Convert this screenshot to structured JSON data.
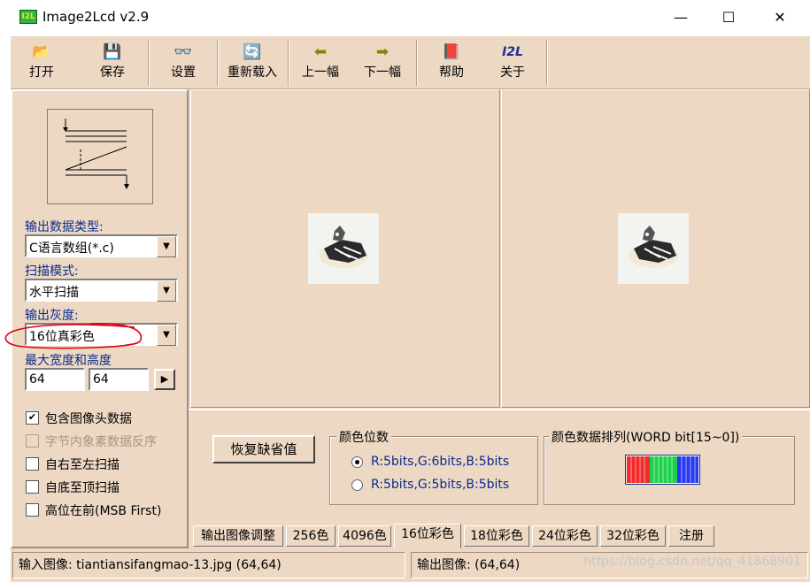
{
  "window": {
    "title": "Image2Lcd v2.9",
    "icon_text": "I2L",
    "colors": {
      "face": "#ecd8c3",
      "label_blue": "#0a2b8e"
    }
  },
  "window_controls": {
    "minimize": "—",
    "maximize": "☐",
    "close": "✕"
  },
  "toolbar": [
    {
      "label": "打开",
      "icon": "open-icon",
      "glyph": "📂"
    },
    {
      "label": "保存",
      "icon": "save-icon",
      "glyph": "💾"
    },
    {
      "label": "设置",
      "icon": "glasses-icon",
      "glyph": "👓"
    },
    {
      "label": "重新载入",
      "icon": "reload-icon",
      "glyph": "🔄"
    },
    {
      "label": "上一幅",
      "icon": "arrow-left-icon",
      "glyph": "⬅"
    },
    {
      "label": "下一幅",
      "icon": "arrow-right-icon",
      "glyph": "➡"
    },
    {
      "label": "帮助",
      "icon": "help-book-icon",
      "glyph": "📕"
    },
    {
      "label": "关于",
      "icon": "i2l-about-icon",
      "glyph": "I2L"
    }
  ],
  "left_panel": {
    "output_type_label": "输出数据类型:",
    "output_type_value": "C语言数组(*.c)",
    "scan_mode_label": "扫描模式:",
    "scan_mode_value": "水平扫描",
    "gray_label": "输出灰度:",
    "gray_value": "16位真彩色",
    "size_label": "最大宽度和高度",
    "width_value": "64",
    "height_value": "64",
    "size_arrow": "▶",
    "checkboxes": [
      {
        "label": "包含图像头数据",
        "checked": true,
        "enabled": true
      },
      {
        "label": "字节内象素数据反序",
        "checked": false,
        "enabled": false
      },
      {
        "label": "自右至左扫描",
        "checked": false,
        "enabled": true
      },
      {
        "label": "自底至顶扫描",
        "checked": false,
        "enabled": true
      },
      {
        "label": "高位在前(MSB First)",
        "checked": false,
        "enabled": true
      }
    ]
  },
  "settings": {
    "restore_button": "恢复缺省值",
    "color_bits_title": "颜色位数",
    "radios": [
      {
        "label": "R:5bits,G:6bits,B:5bits",
        "selected": true
      },
      {
        "label": "R:5bits,G:5bits,B:5bits",
        "selected": false
      }
    ],
    "order_title": "颜色数据排列(WORD bit[15~0])"
  },
  "tabs": [
    {
      "label": "输出图像调整",
      "active": false
    },
    {
      "label": "256色",
      "active": false
    },
    {
      "label": "4096色",
      "active": false
    },
    {
      "label": "16位彩色",
      "active": true
    },
    {
      "label": "18位彩色",
      "active": false
    },
    {
      "label": "24位彩色",
      "active": false
    },
    {
      "label": "32位彩色",
      "active": false
    },
    {
      "label": "注册",
      "active": false
    }
  ],
  "status": {
    "input": "输入图像: tiantiansifangmao-13.jpg (64,64)",
    "output": "输出图像: (64,64)",
    "watermark": "https://blog.csdn.net/qq_41868901"
  }
}
